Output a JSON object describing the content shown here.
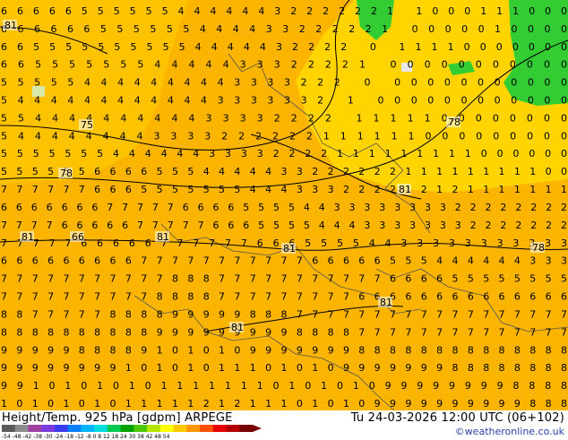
{
  "map": {
    "background_color": "#fbb400",
    "cool_region_color": "#ffd400",
    "green_region_color": "#33cc33",
    "contour_color": "#000000",
    "coastline_color": "#333333",
    "digit_rows": [
      "6666655555544444432222221  1000111000",
      "666666555555444433222221    0000010000",
      "6655555555554444432222 0 11110000000",
      "6655555554444433322221 00000000000",
      "555554444444443333222 0 00000000000",
      "54444444444443333332 1 000000000000",
      "55444444444433332222 1111100000000",
      "5444444443333222222111111000000000",
      "555555544444433332222111111111000000",
      "5555556666555444443322222211111111100",
      "7777776665555555444333222212121111111",
      "66666667777766665555443333333322222222",
      "77776666677777666555544433333332222222",
      "777776666677777766655554433333333333",
      "6666666667777777777766666555444444333",
      "7777777777788877777777777666655555555",
      "7777777777888877777777766666666666666",
      "8877777888899999888777777777777777777",
      "8888888888999999999888877777777777777",
      "9999988889101010999999988888888888888",
      "9999999910101011101010999999988888888",
      "991010101011111110101010999999998888",
      "1010101011111212111010109999999999888"
    ],
    "contour_labels": [
      "75",
      "78",
      "81",
      "81",
      "81",
      "78",
      "81",
      "81",
      "81",
      "78",
      "81",
      "66"
    ]
  },
  "bottom": {
    "title_left": "Height/Temp. 925 hPa [gdpm] ARPEGE",
    "title_right": "Tu 24-03-2026 12:00 UTC (06+102)",
    "credit": "©weatheronline.co.uk",
    "colorbar_ticks": [
      "-54",
      "-48",
      "-42",
      "-38",
      "-30",
      "-24",
      "-18",
      "-12",
      "-8",
      "0",
      "8",
      "12",
      "18",
      "24",
      "30",
      "38",
      "42",
      "48",
      "54"
    ],
    "colorbar_colors": [
      "#5a5a5a",
      "#8c8c8c",
      "#a040a0",
      "#7c3cdc",
      "#3c3cf0",
      "#0080ff",
      "#00b4ff",
      "#00dcdc",
      "#00c850",
      "#00a000",
      "#50c800",
      "#b4e600",
      "#ffff00",
      "#ffc800",
      "#ff9600",
      "#ff5000",
      "#e60000",
      "#b40000",
      "#780000"
    ]
  }
}
